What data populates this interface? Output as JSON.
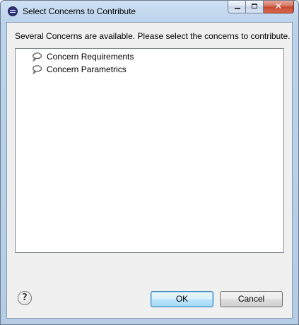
{
  "window": {
    "title": "Select Concerns to Contribute",
    "icon": "eclipse-icon"
  },
  "caption_buttons": {
    "minimize_icon": "minimize-icon",
    "maximize_icon": "maximize-icon",
    "close_glyph": "✕"
  },
  "message": "Several Concerns are available. Please select the concerns to contribute.",
  "concerns": [
    {
      "label": "Concern Requirements",
      "icon": "concern-icon"
    },
    {
      "label": "Concern Parametrics",
      "icon": "concern-icon"
    }
  ],
  "buttons": {
    "help_glyph": "?",
    "ok": "OK",
    "cancel": "Cancel"
  },
  "colors": {
    "window_frame": "#b5cce6",
    "client_bg": "#f0f0f0",
    "default_button_border": "#3c7fb1",
    "close_button": "#c44a32"
  }
}
